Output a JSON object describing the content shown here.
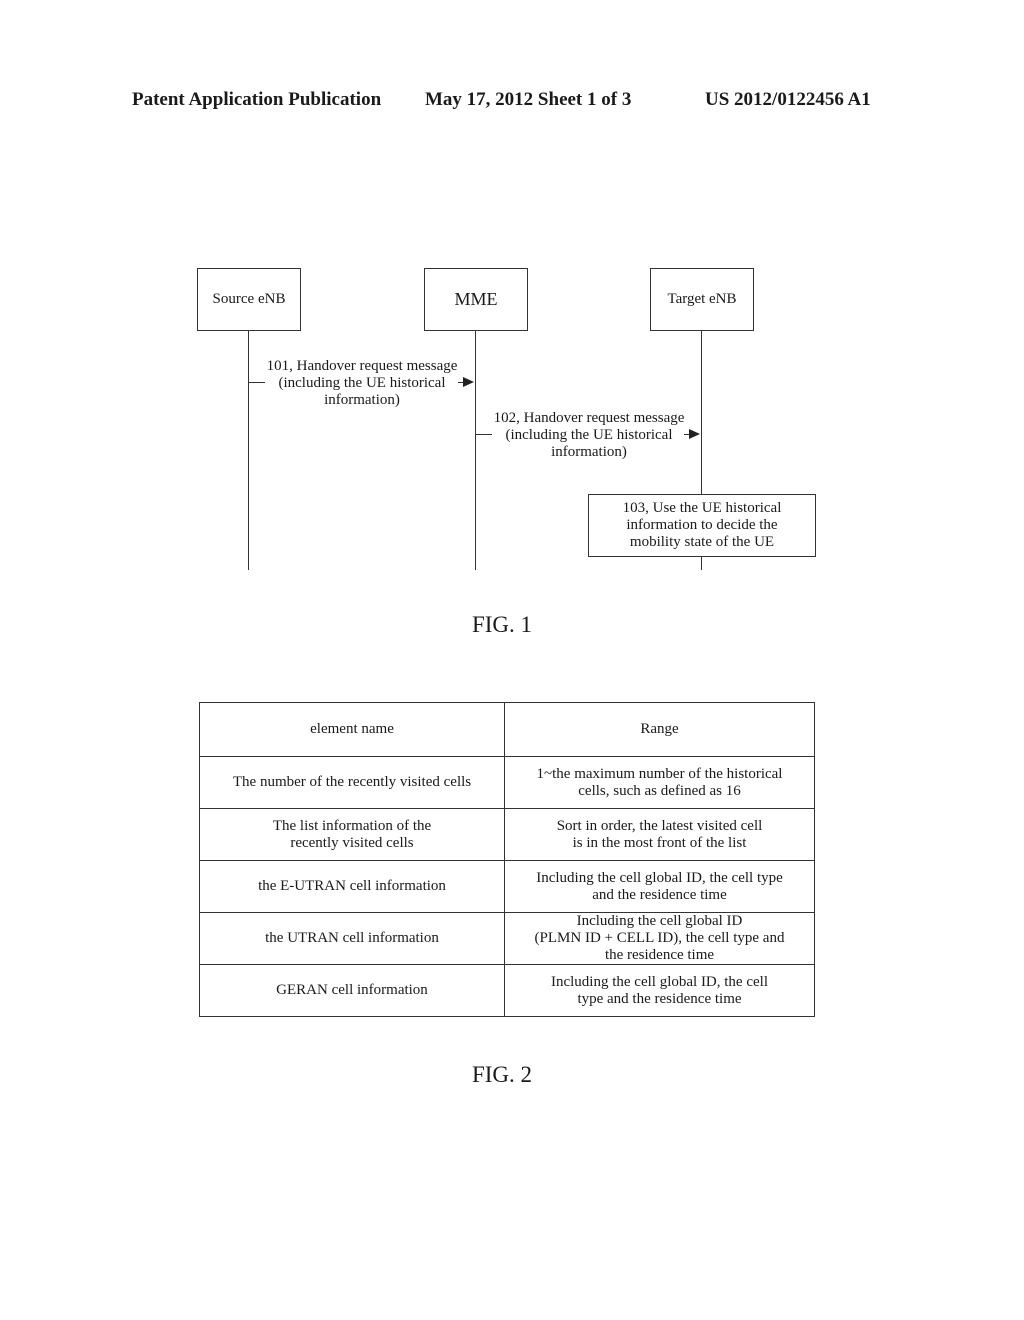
{
  "header": {
    "left": "Patent Application Publication",
    "center": "May 17, 2012   Sheet 1 of 3",
    "right": "US 2012/0122456 A1"
  },
  "fig1": {
    "entities": [
      {
        "name": "Source eNB"
      },
      {
        "name": "MME"
      },
      {
        "name": "Target eNB"
      }
    ],
    "messages": [
      {
        "id": "101",
        "text": "101, Handover request message\n(including the UE historical\ninformation)",
        "from": "Source eNB",
        "to": "MME"
      },
      {
        "id": "102",
        "text": "102, Handover request message\n(including the UE historical\ninformation)",
        "from": "MME",
        "to": "Target eNB"
      }
    ],
    "process": {
      "id": "103",
      "text": "103, Use the UE historical\ninformation to decide the\nmobility state of the UE",
      "at": "Target eNB"
    },
    "caption": "FIG. 1"
  },
  "fig2": {
    "columns": [
      "element name",
      "Range"
    ],
    "rows": [
      [
        "The number of the recently visited cells",
        "1~the maximum number of the historical\ncells, such as defined as 16"
      ],
      [
        "The list information of the\nrecently visited cells",
        "Sort in order, the latest visited cell\nis in the most front of the list"
      ],
      [
        "the E-UTRAN cell information",
        "Including the cell global ID, the cell type\nand the residence time"
      ],
      [
        "the UTRAN cell information",
        "Including the cell global ID\n(PLMN ID + CELL ID), the cell type and\nthe residence time"
      ],
      [
        "GERAN cell information",
        "Including the cell global ID, the cell\ntype and the residence time"
      ]
    ],
    "caption": "FIG. 2"
  }
}
